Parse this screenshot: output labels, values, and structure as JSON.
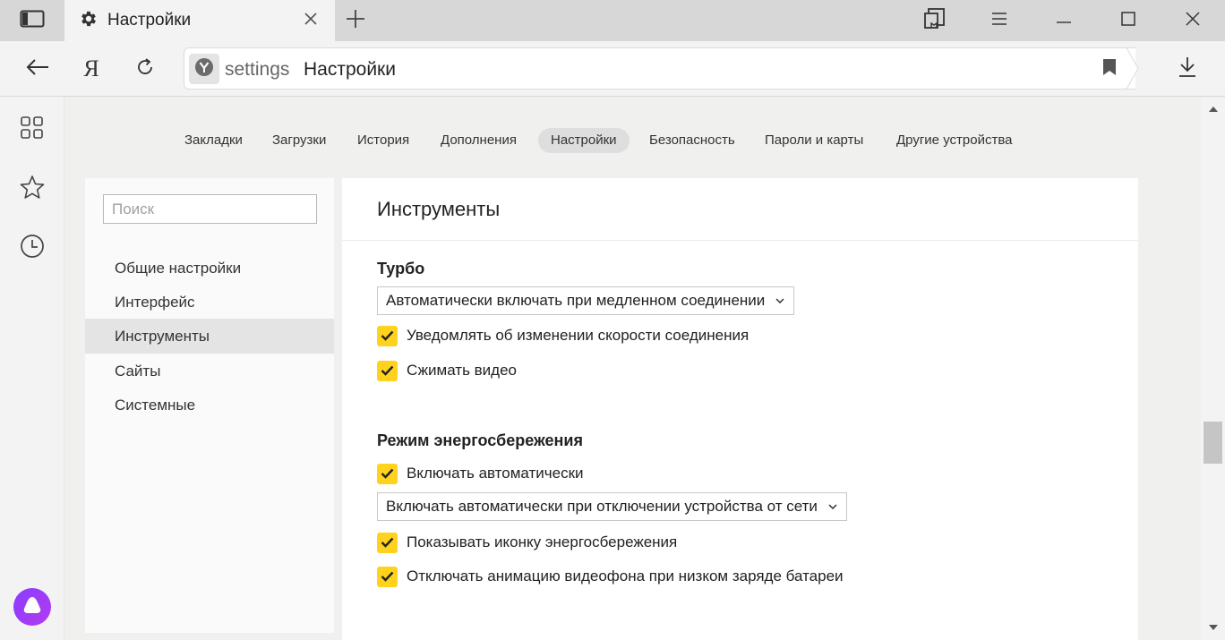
{
  "tab": {
    "title": "Настройки"
  },
  "address_bar": {
    "host": "settings",
    "page_title": "Настройки"
  },
  "toolbar": {
    "yandex_letter": "Я"
  },
  "topnav": {
    "items": [
      "Закладки",
      "Загрузки",
      "История",
      "Дополнения",
      "Настройки",
      "Безопасность",
      "Пароли и карты",
      "Другие устройства"
    ],
    "active": "Настройки"
  },
  "sidebar": {
    "search_placeholder": "Поиск",
    "items": [
      "Общие настройки",
      "Интерфейс",
      "Инструменты",
      "Сайты",
      "Системные"
    ],
    "active": "Инструменты"
  },
  "panel": {
    "title": "Инструменты",
    "turbo": {
      "heading": "Турбо",
      "mode_selected": "Автоматически включать при медленном соединении",
      "checkboxes": [
        {
          "label": "Уведомлять об изменении скорости соединения",
          "checked": true
        },
        {
          "label": "Сжимать видео",
          "checked": true
        }
      ]
    },
    "power_saving": {
      "heading": "Режим энергосбережения",
      "auto_enable": {
        "label": "Включать автоматически",
        "checked": true
      },
      "mode_selected": "Включать автоматически при отключении устройства от сети",
      "checkboxes": [
        {
          "label": "Показывать иконку энергосбережения",
          "checked": true
        },
        {
          "label": "Отключать анимацию видеофона при низком заряде батареи",
          "checked": true
        }
      ]
    }
  },
  "colors": {
    "accent_yellow": "#ffd21e",
    "alice_purple": "#8a3cff"
  },
  "icons": [
    "tabs-panel-icon",
    "gear-icon",
    "close-icon",
    "plus-icon",
    "collections-icon",
    "menu-icon",
    "minimize-icon",
    "maximize-icon",
    "window-close-icon",
    "back-arrow-icon",
    "reload-icon",
    "yandex-browser-icon",
    "bookmark-icon",
    "download-icon",
    "grid-icon",
    "star-icon",
    "clock-icon",
    "alice-icon"
  ]
}
